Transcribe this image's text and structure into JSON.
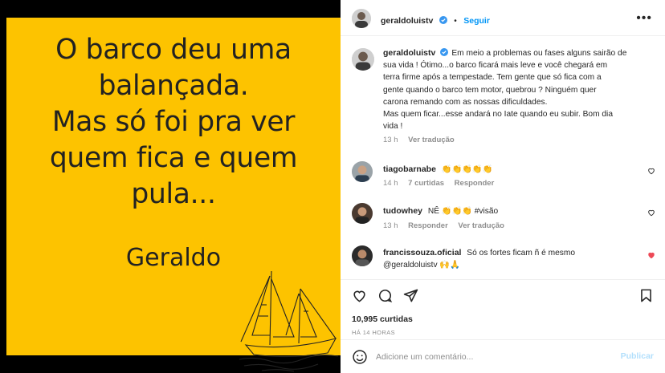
{
  "post_image": {
    "quote_lines": [
      "O barco deu uma",
      "balançada.",
      "Mas só foi pra ver",
      "quem fica e quem",
      "pula..."
    ],
    "signature": "Geraldo",
    "background_color": "#fdc300"
  },
  "header": {
    "username": "geraldoluistv",
    "separator": "•",
    "follow_label": "Seguir",
    "more_icon": "more-horizontal-icon"
  },
  "caption": {
    "username": "geraldoluistv",
    "text_lines": [
      "Em meio a problemas ou fases alguns sairão de",
      "sua vida ! Ótimo...o barco ficará mais leve e você chegará em",
      "terra firme após a tempestade. Tem gente que só fica com a",
      "gente quando o barco tem motor, quebrou ? Ninguém quer",
      "carona remando com as nossas dificuldades.",
      "Mas quem ficar...esse andará no Iate quando eu subir. Bom dia",
      "vida !"
    ],
    "time": "13 h",
    "translate": "Ver tradução"
  },
  "comments": [
    {
      "username": "tiagobarnabe",
      "text": "👏👏👏👏👏",
      "time": "14 h",
      "likes": "7 curtidas",
      "reply": "Responder",
      "liked": false
    },
    {
      "username": "tudowhey",
      "text": "NÊ 👏👏👏 #visão",
      "time": "13 h",
      "reply": "Responder",
      "translate": "Ver tradução",
      "liked": false
    },
    {
      "username": "francissouza.oficial",
      "text": "Só os fortes ficam ñ é mesmo",
      "text2": "@geraldoluistv 🙌🙏",
      "liked": true
    }
  ],
  "actions": {
    "icons": [
      "heart-icon",
      "comment-icon",
      "share-icon",
      "bookmark-icon"
    ]
  },
  "likes_label": "10,995 curtidas",
  "timestamp": "HÁ 14 HORAS",
  "comment_box": {
    "placeholder": "Adicione um comentário...",
    "publish_label": "Publicar"
  },
  "colors": {
    "accent": "#0095f6",
    "verified": "#3897f0",
    "liked_heart": "#ed4956",
    "publish_disabled": "#b2dffc"
  }
}
